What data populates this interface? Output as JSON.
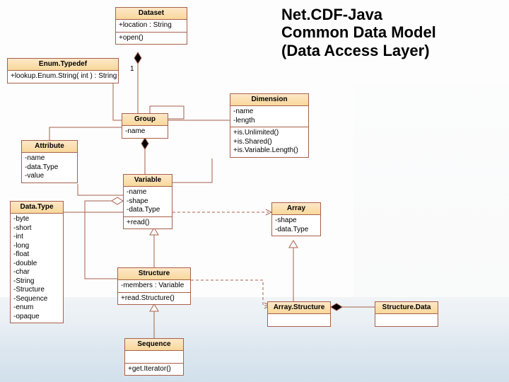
{
  "title": {
    "line1": "Net.CDF-Java",
    "line2": "Common Data Model",
    "line3": "(Data Access Layer)"
  },
  "colors": {
    "border": "#a8604a",
    "headGradTop": "#fde7c8",
    "headGradBot": "#f8d89a"
  },
  "multiplicities": {
    "dataset_group": "1"
  },
  "classes": {
    "dataset": {
      "name": "Dataset",
      "attrs": "+location : String",
      "ops": "+open()"
    },
    "enumtypedef": {
      "name": "Enum.Typedef",
      "attrs": "+lookup.Enum.String( int ) : String"
    },
    "group": {
      "name": "Group",
      "attrs": "-name"
    },
    "dimension": {
      "name": "Dimension",
      "attrs": "-name\n-length",
      "ops": "+is.Unlimited()\n+is.Shared()\n+is.Variable.Length()"
    },
    "attribute": {
      "name": "Attribute",
      "attrs": "-name\n-data.Type\n-value"
    },
    "datatype": {
      "name": "Data.Type",
      "attrs": "-byte\n-short\n-int\n-long\n-float\n-double\n-char\n-String\n-Structure\n-Sequence\n-enum\n-opaque"
    },
    "variable": {
      "name": "Variable",
      "attrs": "-name\n-shape\n-data.Type",
      "ops": "+read()"
    },
    "array": {
      "name": "Array",
      "attrs": "-shape\n-data.Type"
    },
    "structure": {
      "name": "Structure",
      "attrs": "-members : Variable",
      "ops": "+read.Structure()"
    },
    "arraystructure": {
      "name": "Array.Structure"
    },
    "structuredata": {
      "name": "Structure.Data"
    },
    "sequence": {
      "name": "Sequence",
      "ops": "+get.Iterator()"
    }
  }
}
